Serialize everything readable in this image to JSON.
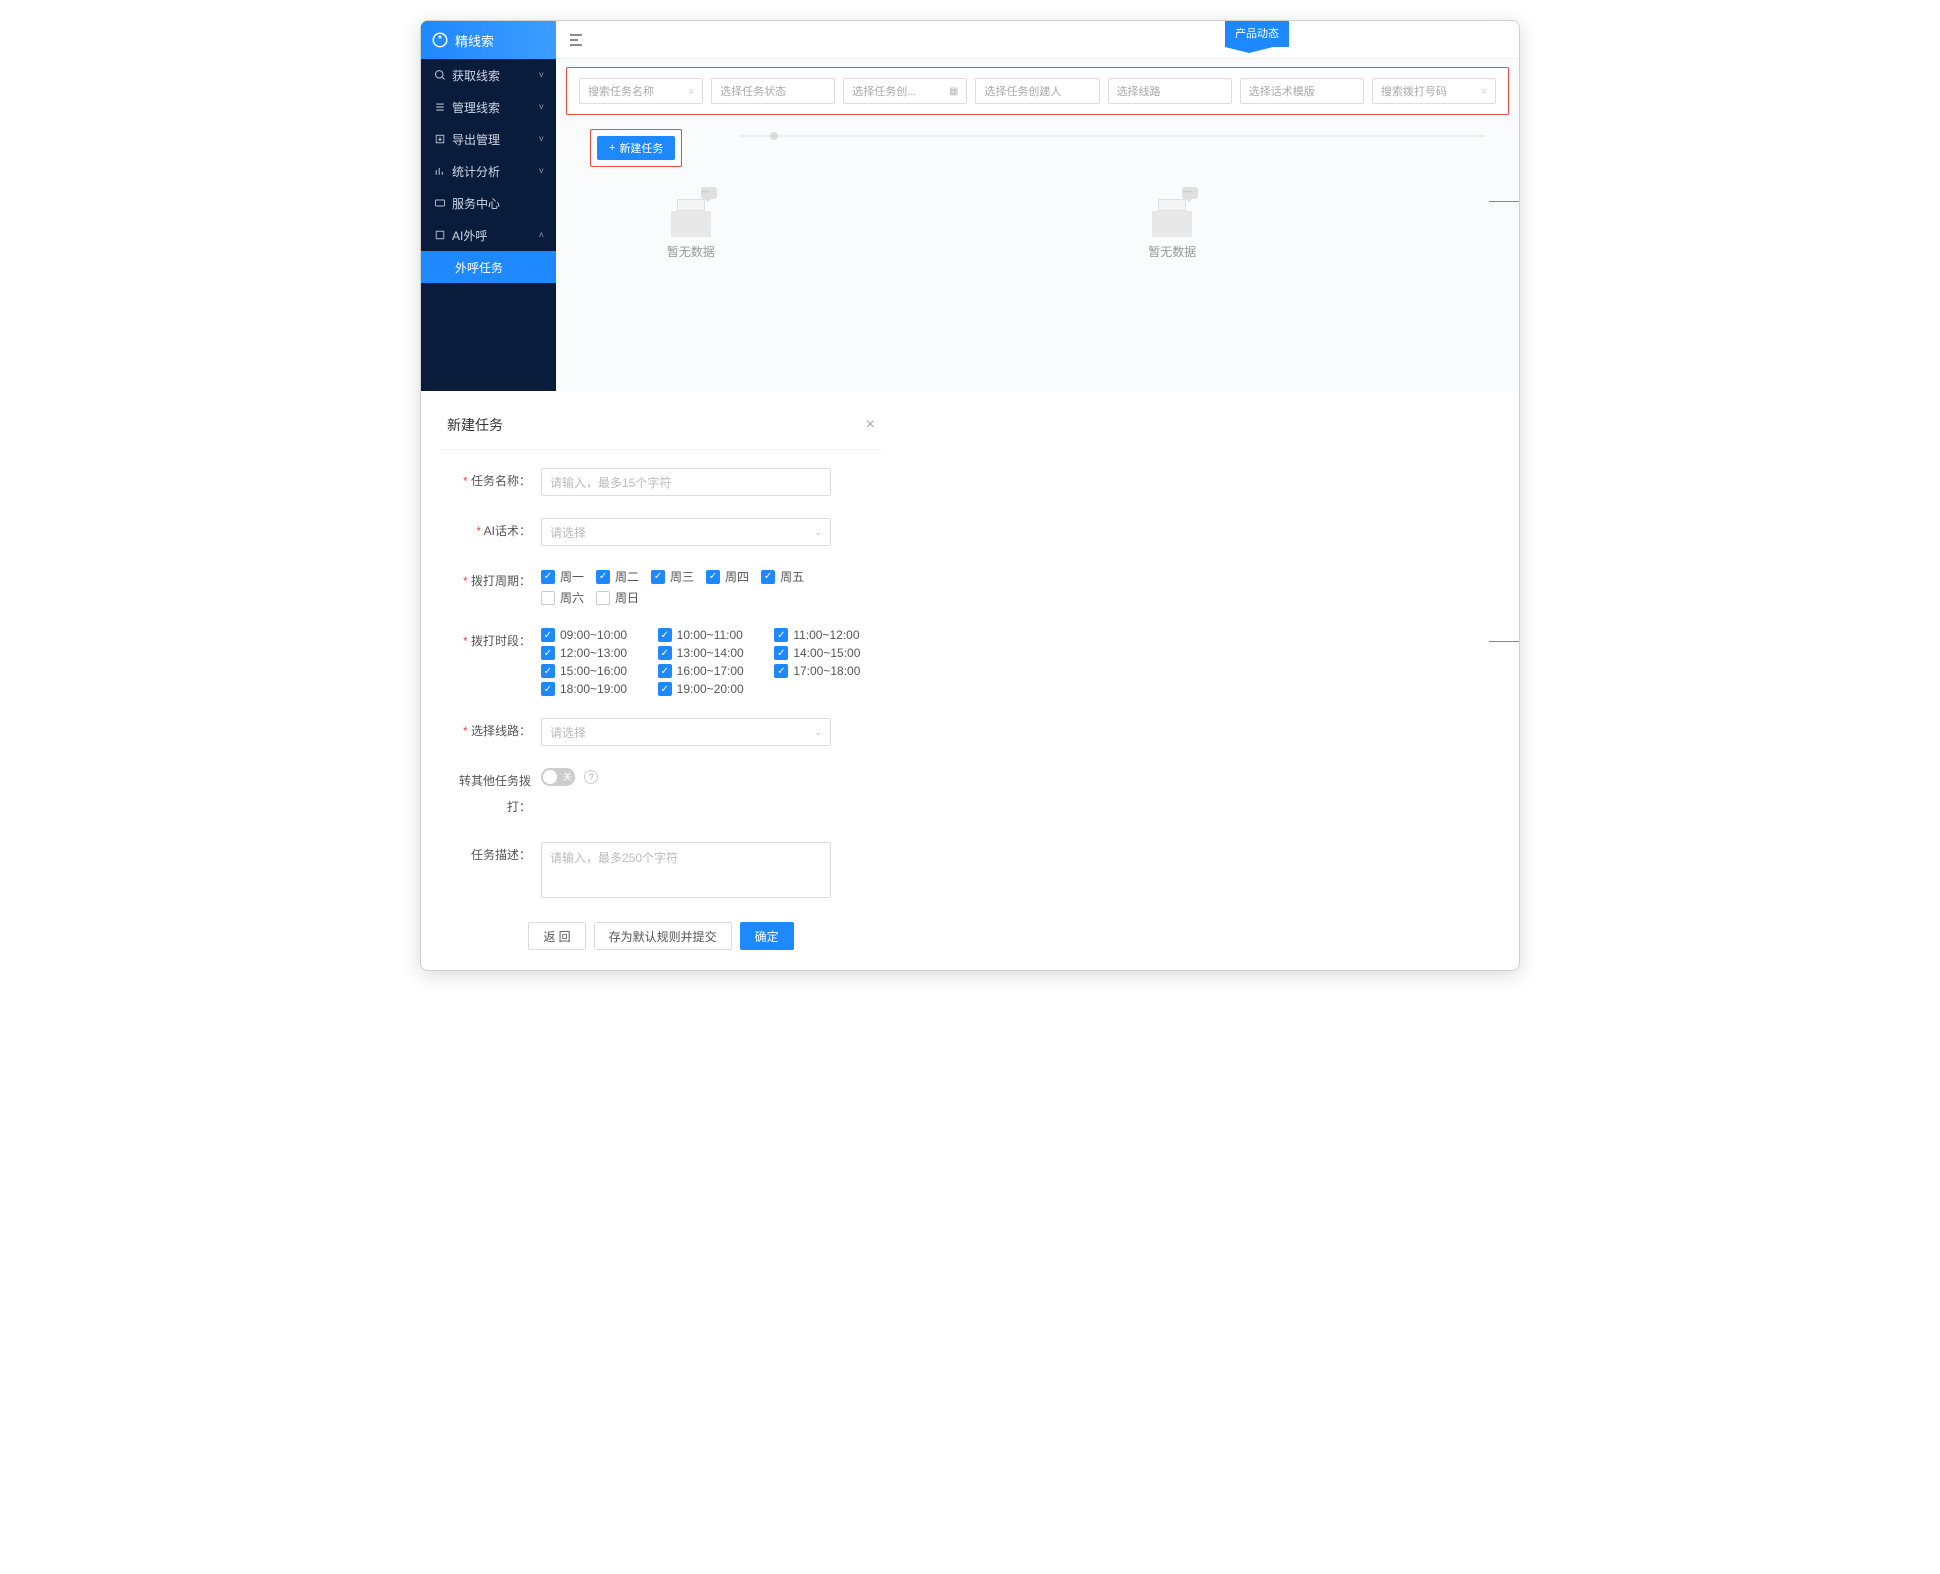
{
  "logo": {
    "name": "精线索"
  },
  "kueyes": null,
  "nav": [
    {
      "icon": "search",
      "label": "获取线索",
      "chevron": "down"
    },
    {
      "icon": "list",
      "label": "管理线索",
      "chevron": "down"
    },
    {
      "icon": "export",
      "label": "导出管理",
      "chevron": "down"
    },
    {
      "icon": "chart",
      "label": "统计分析",
      "chevron": "down"
    },
    {
      "icon": "service",
      "label": "服务中心",
      "chevron": ""
    },
    {
      "icon": "ai",
      "label": "AI外呼",
      "chevron": "up"
    }
  ],
  "subnav": {
    "label": "外呼任务"
  },
  "ribbon": "产品动态",
  "filters": [
    {
      "placeholder": "搜索任务名称",
      "suffix": "search"
    },
    {
      "placeholder": "选择任务状态",
      "suffix": ""
    },
    {
      "placeholder": "选择任务创...",
      "suffix": "date"
    },
    {
      "placeholder": "选择任务创建人",
      "suffix": ""
    },
    {
      "placeholder": "选择线路",
      "suffix": ""
    },
    {
      "placeholder": "选择话术模版",
      "suffix": ""
    },
    {
      "placeholder": "搜索拨打号码",
      "suffix": "search"
    }
  ],
  "newtask_btn": "新建任务",
  "empty_text": "暂无数据",
  "modal": {
    "title": "新建任务",
    "task_name": {
      "label": "任务名称：",
      "placeholder": "请输入，最多15个字符"
    },
    "ai_script": {
      "label": "AI话术：",
      "placeholder": "请选择"
    },
    "dial_cycle": {
      "label": "拨打周期：",
      "days": [
        {
          "label": "周一",
          "checked": true
        },
        {
          "label": "周二",
          "checked": true
        },
        {
          "label": "周三",
          "checked": true
        },
        {
          "label": "周四",
          "checked": true
        },
        {
          "label": "周五",
          "checked": true
        },
        {
          "label": "周六",
          "checked": false
        },
        {
          "label": "周日",
          "checked": false
        }
      ]
    },
    "dial_time": {
      "label": "拨打时段：",
      "slots": [
        {
          "label": "09:00~10:00",
          "checked": true
        },
        {
          "label": "10:00~11:00",
          "checked": true
        },
        {
          "label": "11:00~12:00",
          "checked": true
        },
        {
          "label": "12:00~13:00",
          "checked": true
        },
        {
          "label": "13:00~14:00",
          "checked": true
        },
        {
          "label": "14:00~15:00",
          "checked": true
        },
        {
          "label": "15:00~16:00",
          "checked": true
        },
        {
          "label": "16:00~17:00",
          "checked": true
        },
        {
          "label": "17:00~18:00",
          "checked": true
        },
        {
          "label": "18:00~19:00",
          "checked": true
        },
        {
          "label": "19:00~20:00",
          "checked": true
        }
      ]
    },
    "route": {
      "label": "选择线路：",
      "placeholder": "请选择"
    },
    "transfer": {
      "label": "转其他任务拨打：",
      "value": "关"
    },
    "desc": {
      "label": "任务描述：",
      "placeholder": "请输入，最多250个字符"
    },
    "footer": {
      "back": "返 回",
      "save_default": "存为默认规则并提交",
      "confirm": "确定"
    }
  }
}
